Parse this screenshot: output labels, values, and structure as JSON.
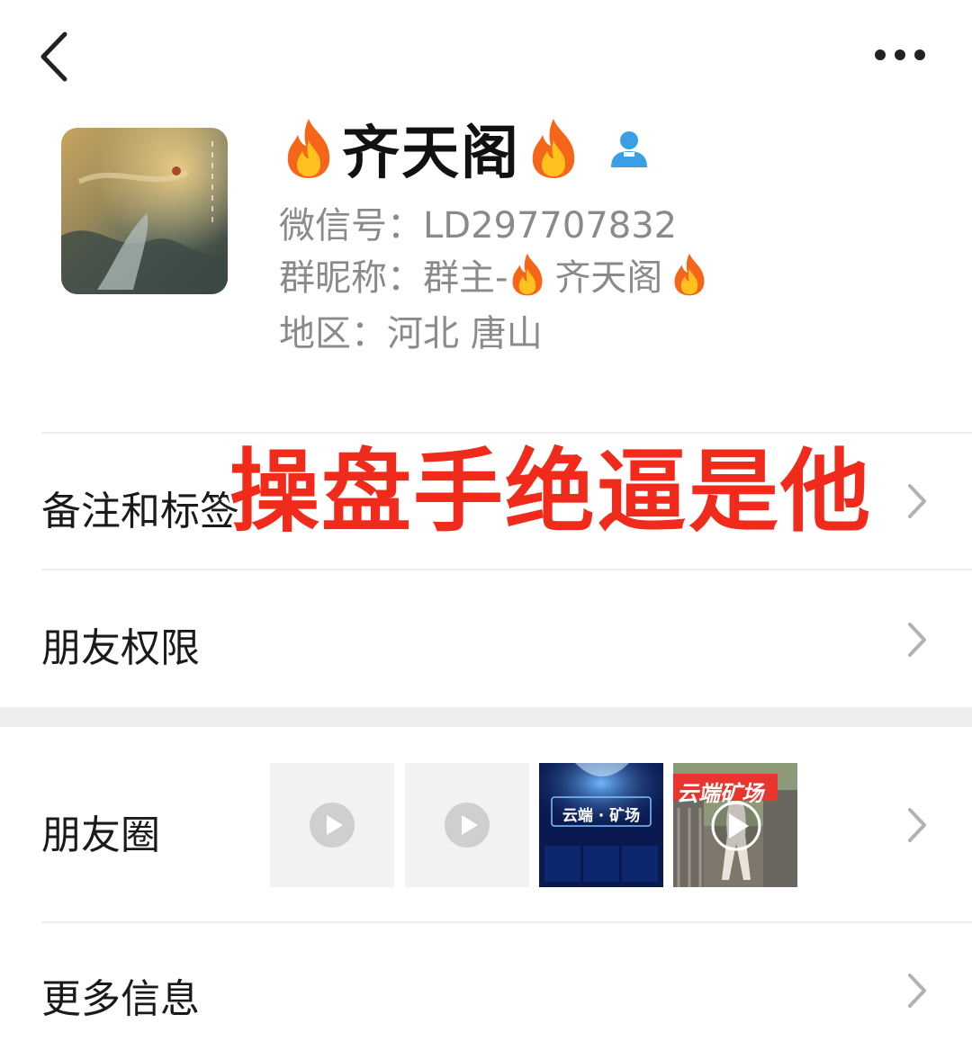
{
  "profile": {
    "name": "齐天阁",
    "wechat_id": "微信号：LD297707832",
    "group_nickname_prefix": "群昵称：群主-",
    "group_nickname_name": "齐天阁",
    "region": "地区：河北 唐山"
  },
  "overlay_caption": "操盘手绝逼是他",
  "rows": {
    "remarks": "备注和标签",
    "permissions": "朋友权限",
    "moments": "朋友圈",
    "more_info": "更多信息"
  },
  "moments_thumbs": {
    "thumb3_title": "云端 · 矿场",
    "thumb4_title": "云端矿场"
  },
  "icons": {
    "back": "back-chevron-icon",
    "more": "more-dots-icon",
    "fire": "fire-emoji-icon",
    "contact": "contact-person-icon",
    "chevron": "chevron-right-icon",
    "play": "play-icon"
  },
  "colors": {
    "overlay_red": "#f02b1b",
    "contact_blue": "#3a9fe3",
    "secondary_text": "#8a8a8a"
  }
}
